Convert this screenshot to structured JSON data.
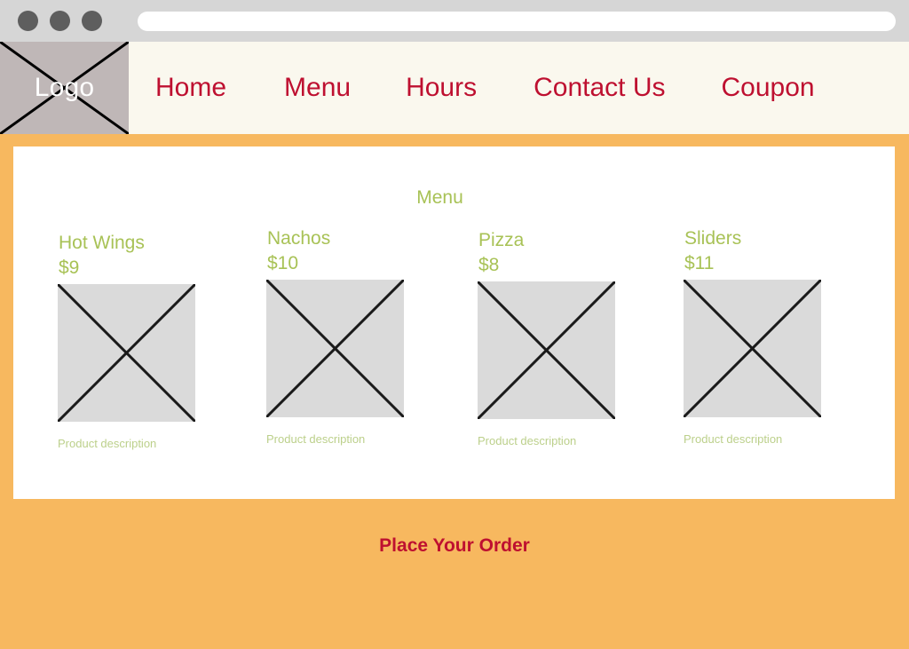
{
  "browser": {
    "traffic_lights": [
      "close",
      "minimize",
      "maximize"
    ],
    "address_bar_value": "",
    "address_bar_placeholder": ""
  },
  "header": {
    "logo_label": "Logo",
    "nav_items": [
      {
        "label": "Home"
      },
      {
        "label": "Menu"
      },
      {
        "label": "Hours"
      },
      {
        "label": "Contact Us"
      },
      {
        "label": "Coupon"
      }
    ]
  },
  "main": {
    "section_title": "Menu",
    "items": [
      {
        "name": "Hot Wings",
        "price": "$9",
        "description": "Product description"
      },
      {
        "name": "Nachos",
        "price": "$10",
        "description": "Product description"
      },
      {
        "name": "Pizza",
        "price": "$8",
        "description": "Product description"
      },
      {
        "name": "Sliders",
        "price": "$11",
        "description": "Product description"
      }
    ]
  },
  "footer": {
    "cta_label": "Place Your Order"
  },
  "colors": {
    "brand_orange": "#f7b85f",
    "header_cream": "#faf8ee",
    "nav_red": "#be1030",
    "menu_green": "#a8c256",
    "desc_green": "#bcd08b",
    "placeholder_gray": "#dadada",
    "logo_gray": "#bfb7b7",
    "chrome_gray": "#d6d6d6"
  }
}
